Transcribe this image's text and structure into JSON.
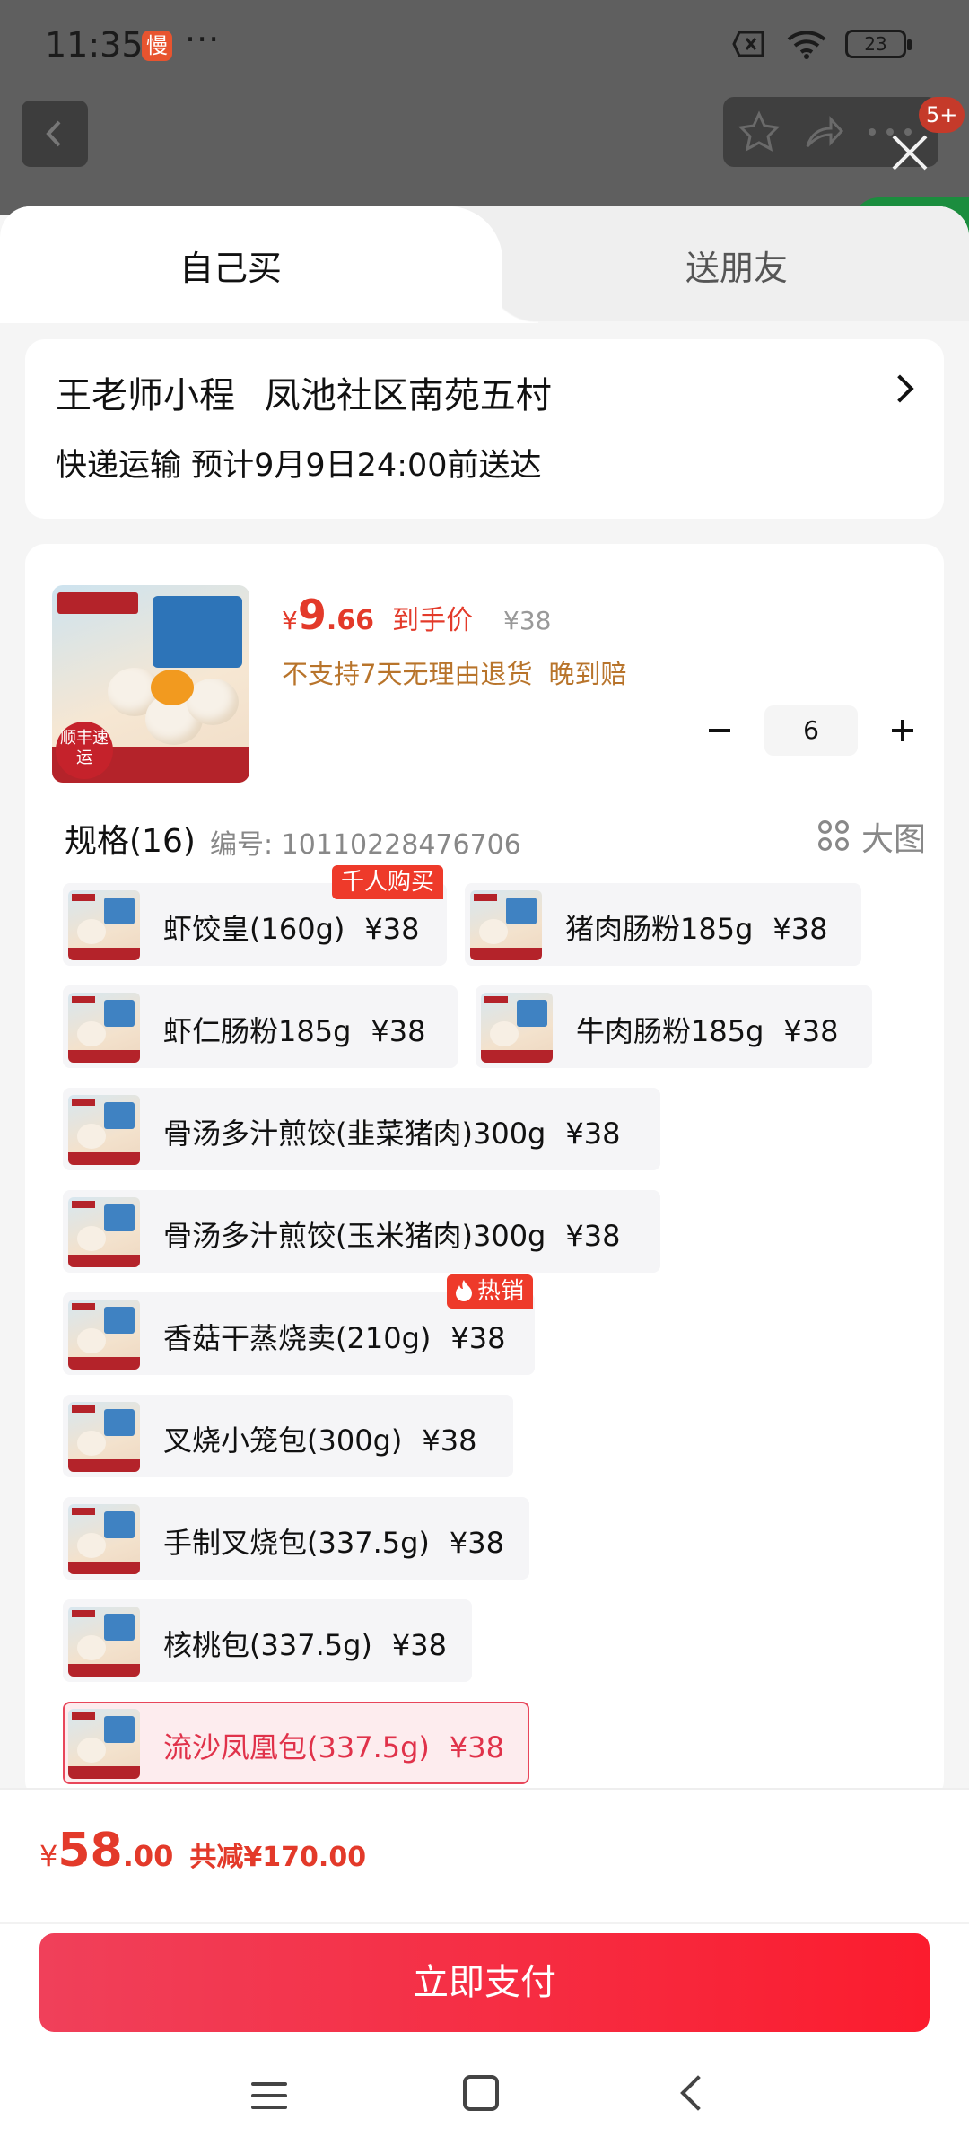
{
  "status_bar": {
    "time": "11:35",
    "app_icon_label": "慢",
    "dots": "···",
    "battery": "23"
  },
  "background": {
    "badge": "5+"
  },
  "tabs": {
    "self_buy": "自己买",
    "send_friend": "送朋友"
  },
  "address": {
    "recipient": "王老师小程",
    "location": "凤池社区南苑五村",
    "delivery": "快递运输 预计9月9日24:00前送达"
  },
  "product": {
    "image_text": {
      "seal": "顺丰速运"
    },
    "price_symbol": "¥",
    "price_int": "9",
    "price_dec": ".66",
    "price_tag": "到手价",
    "original_price": "¥38",
    "policy_1": "不支持7天无理由退货",
    "policy_2": "晚到赔",
    "quantity": "6"
  },
  "spec": {
    "title": "规格(16)",
    "code": "编号: 10110228476706",
    "big_view": "大图"
  },
  "options": [
    {
      "name": "虾饺皇(160g)",
      "price": "¥38",
      "badge": "千人购买"
    },
    {
      "name": "猪肉肠粉185g",
      "price": "¥38"
    },
    {
      "name": "虾仁肠粉185g",
      "price": "¥38"
    },
    {
      "name": "牛肉肠粉185g",
      "price": "¥38"
    },
    {
      "name": "骨汤多汁煎饺(韭菜猪肉)300g",
      "price": "¥38"
    },
    {
      "name": "骨汤多汁煎饺(玉米猪肉)300g",
      "price": "¥38"
    },
    {
      "name": "香菇干蒸烧卖(210g)",
      "price": "¥38",
      "badge": "热销"
    },
    {
      "name": "叉烧小笼包(300g)",
      "price": "¥38"
    },
    {
      "name": "手制叉烧包(337.5g)",
      "price": "¥38"
    },
    {
      "name": "核桃包(337.5g)",
      "price": "¥38"
    },
    {
      "name": "流沙凤凰包(337.5g)",
      "price": "¥38",
      "selected": true
    }
  ],
  "footer": {
    "currency": "¥",
    "total_int": "58",
    "total_dec": ".00",
    "savings": "共减¥170.00",
    "pay_button": "立即支付"
  },
  "colors": {
    "accent": "#e33a2a",
    "pay_gradient_start": "#f0405a",
    "pay_gradient_end": "#fb1c2e",
    "policy": "#b8742b"
  }
}
